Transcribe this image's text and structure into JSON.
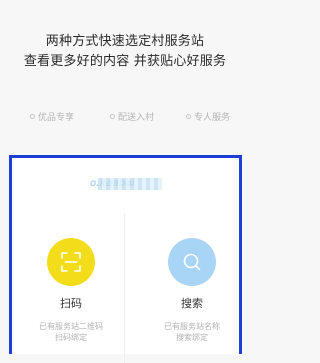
{
  "headline": {
    "line1": "两种方式快速选定村服务站",
    "line2": "查看更多好的内容 并获贴心好服务"
  },
  "features": [
    {
      "label": "优品专享"
    },
    {
      "label": "配送入村"
    },
    {
      "label": "专人服务"
    }
  ],
  "panel": {
    "account_text": "o.kaabai",
    "actions": [
      {
        "id": "scan",
        "icon": "qr-scan-icon",
        "label": "扫码",
        "desc_line1": "已有服务站二维码",
        "desc_line2": "扫码绑定"
      },
      {
        "id": "search",
        "icon": "search-icon",
        "label": "搜索",
        "desc_line1": "已有服务站名称",
        "desc_line2": "搜索绑定"
      }
    ]
  },
  "colors": {
    "scan_circle": "#f3dc1a",
    "search_circle": "#a8d4f6",
    "panel_border": "#1e3fd6"
  }
}
